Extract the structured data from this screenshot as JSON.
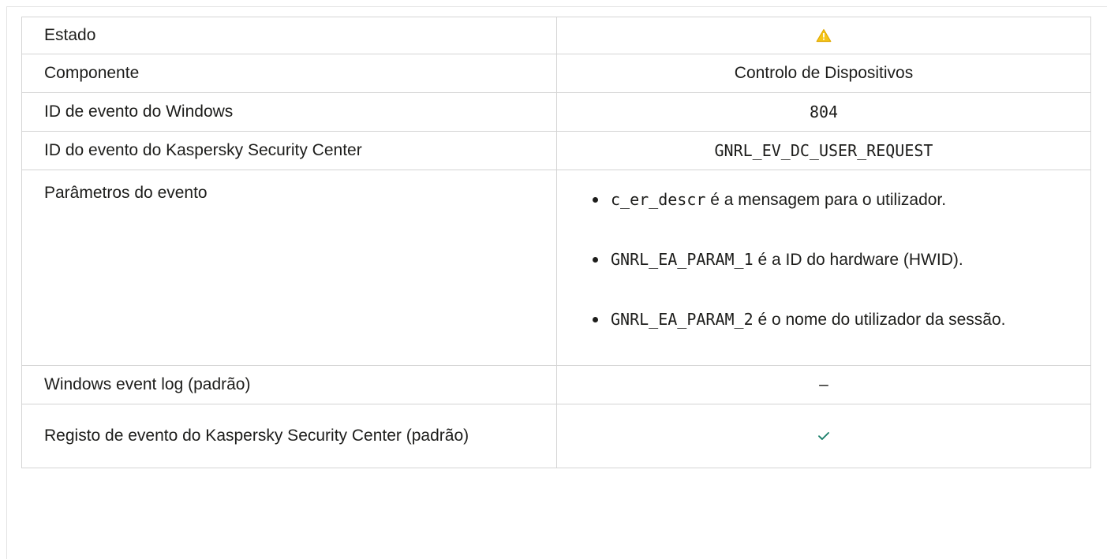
{
  "rows": {
    "status": {
      "label": "Estado",
      "icon": "warning-icon"
    },
    "component": {
      "label": "Componente",
      "value": "Controlo de Dispositivos"
    },
    "windows_event_id": {
      "label": "ID de evento do Windows",
      "value": "804"
    },
    "ksc_event_id": {
      "label": "ID do evento do Kaspersky Security Center",
      "value": "GNRL_EV_DC_USER_REQUEST"
    },
    "event_params": {
      "label": "Parâmetros do evento",
      "items": [
        {
          "code": "c_er_descr",
          "text": " é a mensagem para o utilizador."
        },
        {
          "code": "GNRL_EA_PARAM_1",
          "text": " é a ID do hardware (HWID)."
        },
        {
          "code": "GNRL_EA_PARAM_2",
          "text": " é o nome do utilizador da sessão."
        }
      ]
    },
    "windows_event_log": {
      "label": "Windows event log (padrão)",
      "value": "–"
    },
    "ksc_event_log": {
      "label": "Registo de evento do Kaspersky Security Center (padrão)",
      "icon": "checkmark-icon"
    }
  },
  "colors": {
    "warning": "#f5c518",
    "check": "#1a7f6a",
    "border": "#d4d4d4"
  }
}
